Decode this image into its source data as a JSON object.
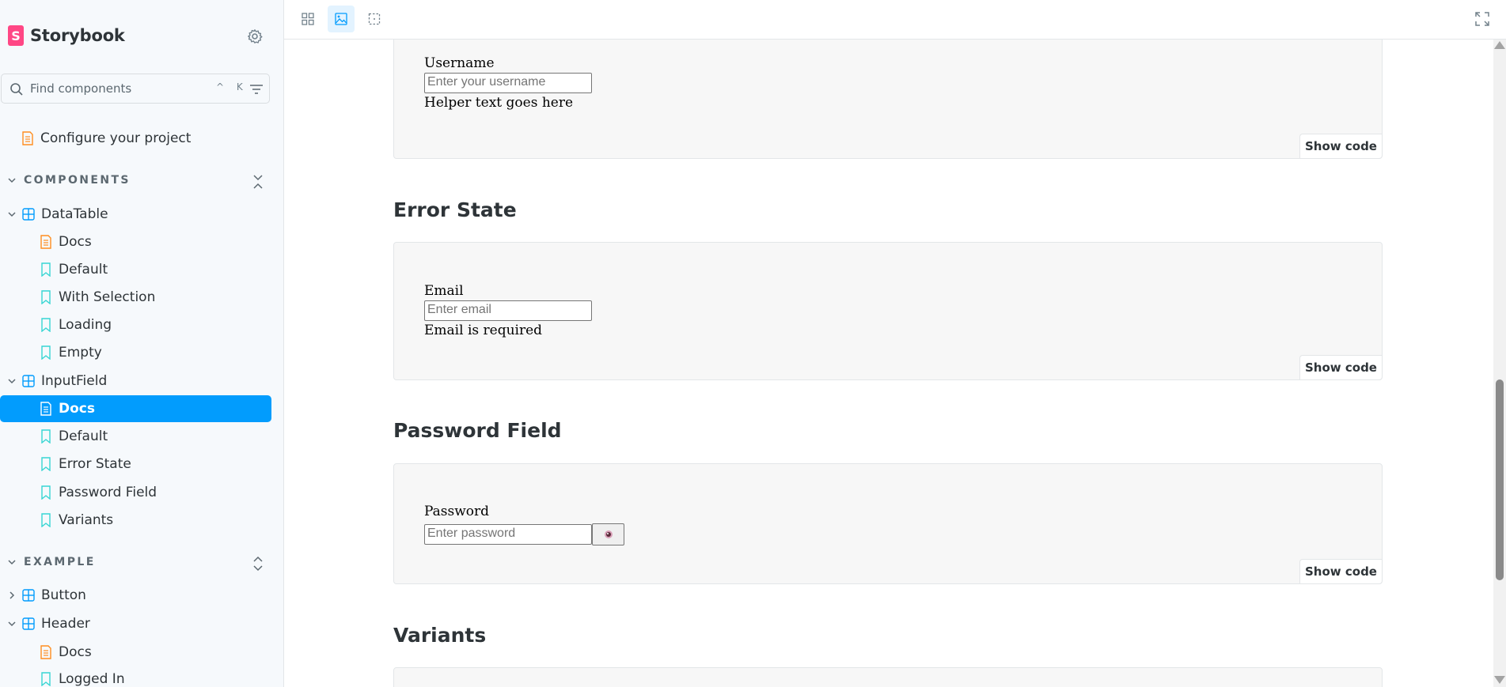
{
  "app": {
    "title": "Storybook",
    "logo_letter": "S"
  },
  "search": {
    "placeholder": "Find components",
    "shortcut": "^ K"
  },
  "sidebar": {
    "top_item": "Configure your project",
    "sections": [
      {
        "label": "COMPONENTS",
        "groups": [
          {
            "label": "DataTable",
            "children": [
              "Docs",
              "Default",
              "With Selection",
              "Loading",
              "Empty"
            ]
          },
          {
            "label": "InputField",
            "children": [
              "Docs",
              "Default",
              "Error State",
              "Password Field",
              "Variants"
            ]
          }
        ]
      },
      {
        "label": "EXAMPLE",
        "groups": [
          {
            "label": "Button",
            "children": []
          },
          {
            "label": "Header",
            "children": [
              "Docs",
              "Logged In"
            ]
          }
        ]
      }
    ],
    "selected": "InputField / Docs"
  },
  "stories": [
    {
      "heading": "",
      "label": "Username",
      "placeholder": "Enter your username",
      "helper": "Helper text goes here",
      "show_code": "Show code"
    },
    {
      "heading": "Error State",
      "label": "Email",
      "placeholder": "Enter email",
      "helper": "Email is required",
      "show_code": "Show code"
    },
    {
      "heading": "Password Field",
      "label": "Password",
      "placeholder": "Enter password",
      "toggle_icon": "eye-icon",
      "show_code": "Show code"
    },
    {
      "heading": "Variants"
    }
  ],
  "colors": {
    "accent": "#029cfd",
    "brand": "#ff4785",
    "doc_icon": "#ff8d1f",
    "story_icon": "#37d5d3",
    "component_icon": "#029cfd"
  }
}
